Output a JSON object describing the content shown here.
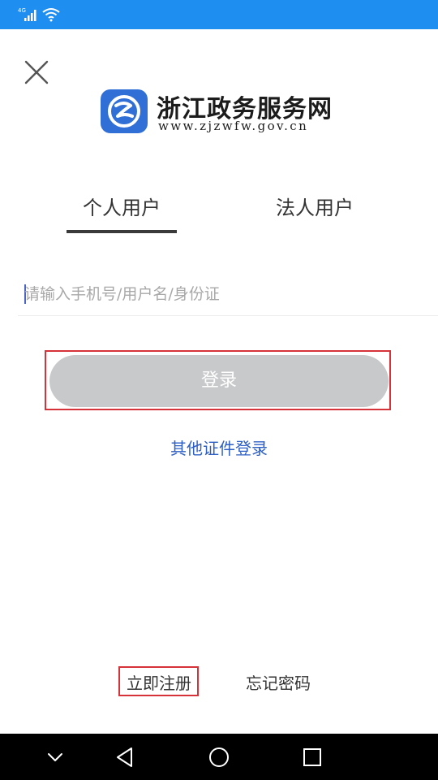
{
  "status_bar": {
    "network_label": "4G",
    "color": "#1f8ef1"
  },
  "icons": {
    "close": "close-icon",
    "logo": "zj-gov-logo-icon",
    "signal": "signal-icon",
    "wifi": "wifi-icon",
    "collapse": "chevron-down-icon",
    "back": "back-triangle-icon",
    "home": "home-circle-icon",
    "recent": "recent-square-icon"
  },
  "brand": {
    "title": "浙江政务服务网",
    "url": "www.zjzwfw.gov.cn",
    "logo_color": "#2f6fd6"
  },
  "tabs": [
    {
      "label": "个人用户",
      "selected": true
    },
    {
      "label": "法人用户",
      "selected": false
    }
  ],
  "login_form": {
    "username_placeholder": "请输入手机号/用户名/身份证",
    "username_value": "",
    "login_label": "登录",
    "other_login_label": "其他证件登录"
  },
  "footer": {
    "register_label": "立即注册",
    "forgot_label": "忘记密码"
  },
  "colors": {
    "highlight": "#d6323a",
    "link": "#2d5fc4",
    "button_disabled": "#c8c9cb"
  }
}
